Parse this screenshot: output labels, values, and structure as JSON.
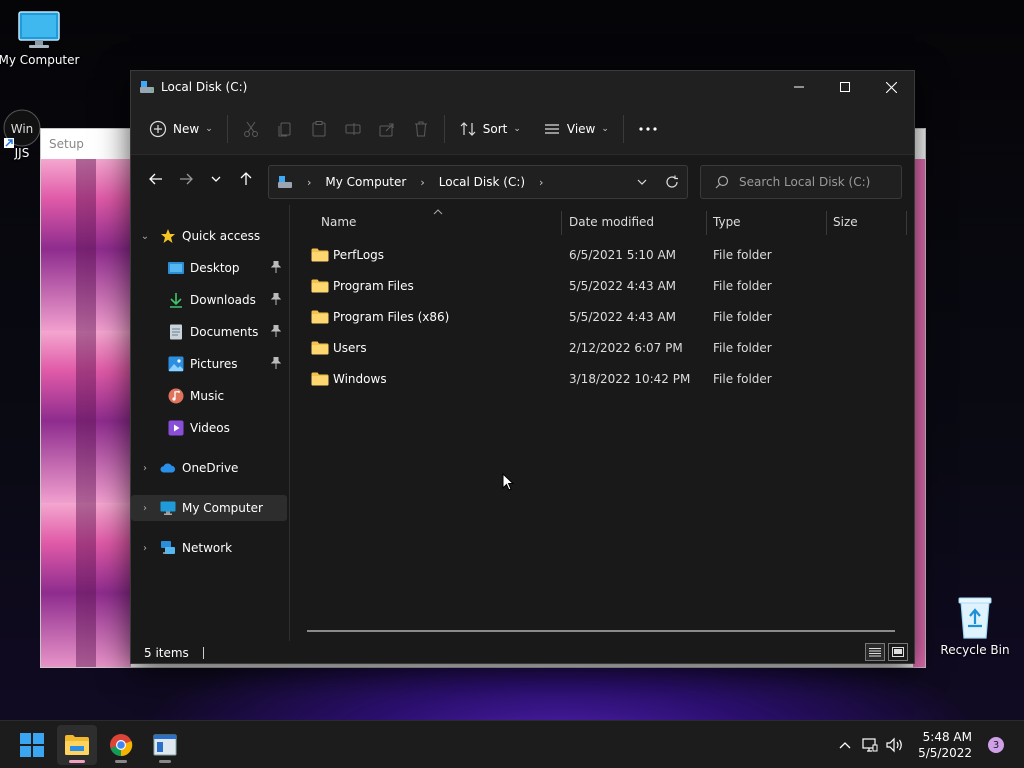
{
  "desktop": {
    "my_computer_label": "My Computer",
    "jjs_label": "JJS",
    "recycle_bin_label": "Recycle Bin"
  },
  "setup_window": {
    "title": "Setup"
  },
  "explorer": {
    "title": "Local Disk (C:)",
    "toolbar": {
      "new_label": "New",
      "sort_label": "Sort",
      "view_label": "View"
    },
    "address": {
      "crumbs": [
        "My Computer",
        "Local Disk (C:)"
      ]
    },
    "search": {
      "placeholder": "Search Local Disk (C:)"
    },
    "sidebar": {
      "quick_access": "Quick access",
      "items": [
        "Desktop",
        "Downloads",
        "Documents",
        "Pictures",
        "Music",
        "Videos"
      ],
      "onedrive": "OneDrive",
      "my_computer": "My Computer",
      "network": "Network"
    },
    "columns": {
      "name": "Name",
      "date": "Date modified",
      "type": "Type",
      "size": "Size"
    },
    "files": [
      {
        "name": "PerfLogs",
        "date": "6/5/2021 5:10 AM",
        "type": "File folder"
      },
      {
        "name": "Program Files",
        "date": "5/5/2022 4:43 AM",
        "type": "File folder"
      },
      {
        "name": "Program Files (x86)",
        "date": "5/5/2022 4:43 AM",
        "type": "File folder"
      },
      {
        "name": "Users",
        "date": "2/12/2022 6:07 PM",
        "type": "File folder"
      },
      {
        "name": "Windows",
        "date": "3/18/2022 10:42 PM",
        "type": "File folder"
      }
    ],
    "status": {
      "item_count": "5 items"
    }
  },
  "taskbar": {
    "time": "5:48 AM",
    "date": "5/5/2022",
    "notification_count": "3"
  },
  "colors": {
    "folder": "#f2c14e",
    "accent": "#4cc2ff",
    "window_bg": "#191919"
  }
}
